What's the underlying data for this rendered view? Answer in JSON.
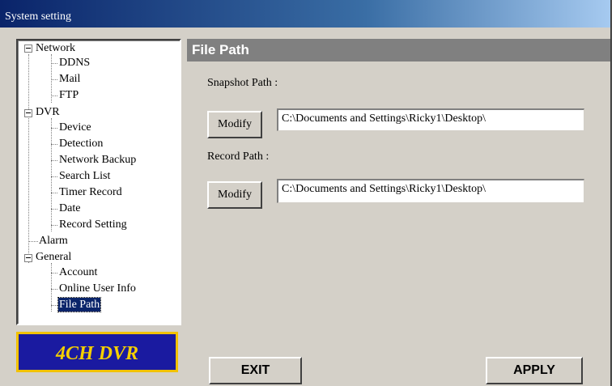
{
  "window": {
    "title": "System setting"
  },
  "tree": {
    "network": {
      "label": "Network",
      "children": [
        "DDNS",
        "Mail",
        "FTP"
      ]
    },
    "dvr": {
      "label": "DVR",
      "children": [
        "Device",
        "Detection",
        "Network Backup",
        "Search List",
        "Timer Record",
        "Date",
        "Record Setting"
      ]
    },
    "alarm": {
      "label": "Alarm"
    },
    "general": {
      "label": "General",
      "children": [
        "Account",
        "Online User Info",
        "File Path"
      ]
    }
  },
  "logo": {
    "text": "4CH DVR"
  },
  "panel": {
    "title": "File Path",
    "snapshot": {
      "label": "Snapshot Path :",
      "button": "Modify",
      "value": "C:\\Documents and Settings\\Ricky1\\Desktop\\"
    },
    "record": {
      "label": "Record Path :",
      "button": "Modify",
      "value": "C:\\Documents and Settings\\Ricky1\\Desktop\\"
    }
  },
  "footer": {
    "exit_label": "EXIT",
    "apply_label": "APPLY"
  }
}
